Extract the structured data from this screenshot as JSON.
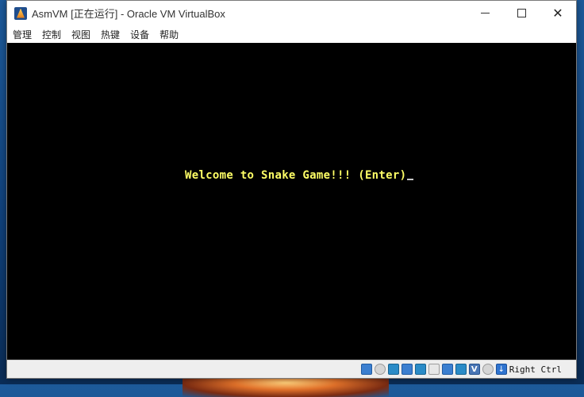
{
  "window": {
    "title": "AsmVM [正在运行] - Oracle VM VirtualBox"
  },
  "menu": [
    "管理",
    "控制",
    "视图",
    "热键",
    "设备",
    "帮助"
  ],
  "screen": {
    "message": "Welcome to Snake Game!!! (Enter)"
  },
  "statusbar": {
    "icons": [
      "hard-disk-icon",
      "optical-drive-icon",
      "audio-icon",
      "network-icon",
      "usb-icon",
      "shared-folders-icon",
      "display-icon",
      "video-capture-icon",
      "virtualization-icon",
      "mouse-integration-icon",
      "host-key-icon"
    ],
    "host_key_label": "Right Ctrl"
  },
  "colors": {
    "vm_text": "#ffff66",
    "vm_background": "#000000"
  }
}
